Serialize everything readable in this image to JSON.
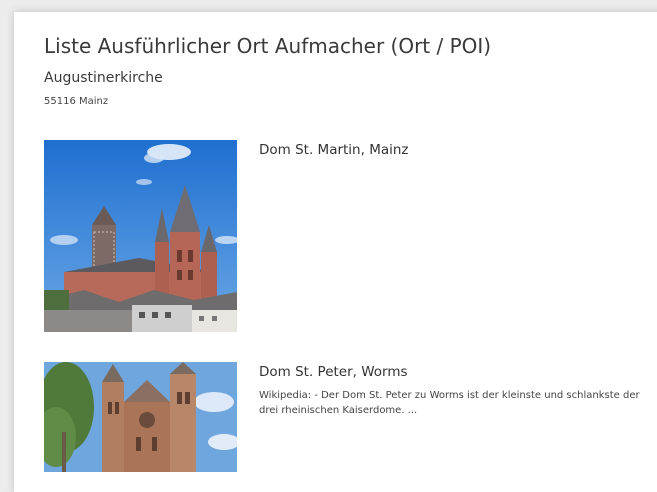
{
  "page": {
    "title": "Liste Ausführlicher Ort Aufmacher (Ort / POI)",
    "subtitle": "Augustinerkirche",
    "address": "55116 Mainz"
  },
  "items": [
    {
      "name": "Dom St. Martin, Mainz",
      "description": ""
    },
    {
      "name": "Dom St. Peter, Worms",
      "description": "Wikipedia: - Der Dom St. Peter zu Worms ist der kleinste und schlankste der drei rheinischen Kaiserdome. ..."
    }
  ],
  "colors": {
    "sky": "#2f7fd6",
    "sandstone": "#b86a5a",
    "roof": "#5c5a5e"
  }
}
